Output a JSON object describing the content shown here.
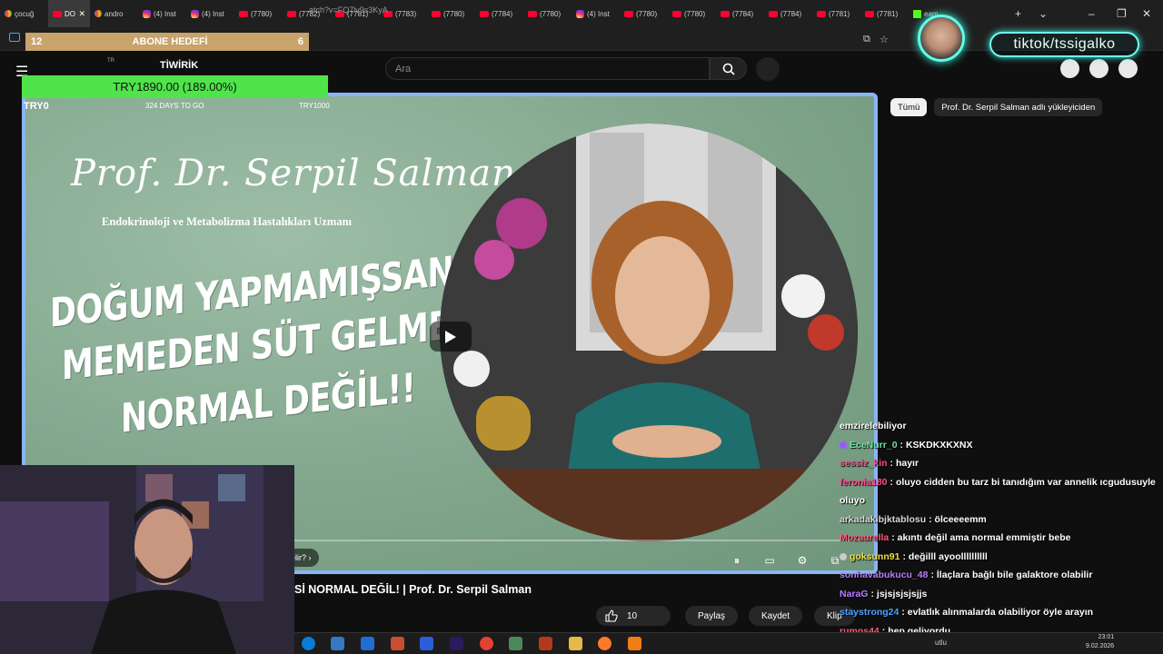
{
  "browser": {
    "tabs": [
      {
        "label": "çocuğ",
        "icon": "google-icon",
        "active": false
      },
      {
        "label": "DO",
        "icon": "youtube-icon",
        "active": true
      },
      {
        "label": "andro",
        "icon": "google-icon",
        "active": false
      },
      {
        "label": "(4) Inst",
        "icon": "instagram-icon",
        "active": false
      },
      {
        "label": "(4) Inst",
        "icon": "instagram-icon",
        "active": false
      },
      {
        "label": "(7780)",
        "icon": "youtube-icon",
        "active": false
      },
      {
        "label": "(7782)",
        "icon": "youtube-icon",
        "active": false
      },
      {
        "label": "(7781)",
        "icon": "youtube-icon",
        "active": false
      },
      {
        "label": "(7783)",
        "icon": "youtube-icon",
        "active": false
      },
      {
        "label": "(7780)",
        "icon": "youtube-icon",
        "active": false
      },
      {
        "label": "(7784)",
        "icon": "youtube-icon",
        "active": false
      },
      {
        "label": "(7780)",
        "icon": "youtube-icon",
        "active": false
      },
      {
        "label": "(4) Inst",
        "icon": "instagram-icon",
        "active": false
      },
      {
        "label": "(7780)",
        "icon": "youtube-icon",
        "active": false
      },
      {
        "label": "(7780)",
        "icon": "youtube-icon",
        "active": false
      },
      {
        "label": "(7784)",
        "icon": "youtube-icon",
        "active": false
      },
      {
        "label": "(7784)",
        "icon": "youtube-icon",
        "active": false
      },
      {
        "label": "(7781)",
        "icon": "youtube-icon",
        "active": false
      },
      {
        "label": "(7781)",
        "icon": "youtube-icon",
        "active": false
      }
    ],
    "kick_tab_label": "eam",
    "url_fragment": "atch?v=FQ7lv9s3KyA"
  },
  "overlay": {
    "abone_left": "12",
    "abone_title": "ABONE HEDEFİ",
    "abone_right": "6",
    "tr_code": "TR",
    "brand": "TİWİRİK",
    "goal_value": "TRY1890.00 (189.00%)",
    "goal_progress": 1.0,
    "goal_low": "TRY0",
    "goal_days": "324 DAYS TO GO",
    "goal_high": "TRY1000",
    "tiktok": "tiktok/tssigalko"
  },
  "youtube": {
    "search_placeholder": "Ara",
    "chips": [
      "Tümü",
      "Prof. Dr. Serpil Salman adlı yükleyiciden"
    ],
    "thumbnail": {
      "name": "Prof. Dr. Serpil Salman",
      "specialty": "Endokrinoloji ve Metabolizma Hastalıkları Uzmanı",
      "headline_1": "DOĞUM YAPMAMIŞSANIZ",
      "headline_2": "MEMEDEN SÜT GELMESİ",
      "headline_3": "NORMAL DEĞİL!!"
    },
    "player_hint": "elir? ›",
    "video_title": "Sİ NORMAL DEĞİL! | Prof. Dr. Serpil Salman",
    "likes": "10",
    "share_label": "Paylaş",
    "save_label": "Kaydet",
    "clip_label": "Klip"
  },
  "chat": [
    {
      "user": "",
      "text": "emzirelebiliyor",
      "color": "#ffffff"
    },
    {
      "user": "EceNurr_0",
      "text": ": KSKDKXKXNX",
      "color": "#6fe3a5",
      "badge": "#9b59ff"
    },
    {
      "user": "sessiz_kin",
      "text": ": hayır",
      "color": "#ff4d8f"
    },
    {
      "user": "feronia180",
      "text": ": oluyo cidden bu tarz bi tanıdığım var annelik ıcgudusuyle oluyo",
      "color": "#ff4d8f"
    },
    {
      "user": "arkadakibjktablosu",
      "text": ": ölceeeemm",
      "color": "#d8d8d8"
    },
    {
      "user": "Mozaurella",
      "text": ": akıntı değil ama normal emmiştir bebe",
      "color": "#ff5a7a"
    },
    {
      "user": "goksunn91",
      "text": ": değilll ayoollllllllll",
      "color": "#f0e04a",
      "badge": "#cccccc"
    },
    {
      "user": "sonhavabukucu_48",
      "text": ": İlaçlara bağlı bile galaktore olabilir",
      "color": "#b87cff"
    },
    {
      "user": "NaraG",
      "text": ": jsjsjsjsjsjjs",
      "color": "#b87cff"
    },
    {
      "user": "staystrong24",
      "text": ": evlatlık alınmalarda olabiliyor öyle arayın",
      "color": "#4aa3ff"
    },
    {
      "user": "rumos44",
      "text": ": hep geliyordu",
      "color": "#ff5a7a"
    }
  ],
  "taskbar": {
    "time": "23:01",
    "date": "9.02.2026",
    "weather": "utlu"
  }
}
